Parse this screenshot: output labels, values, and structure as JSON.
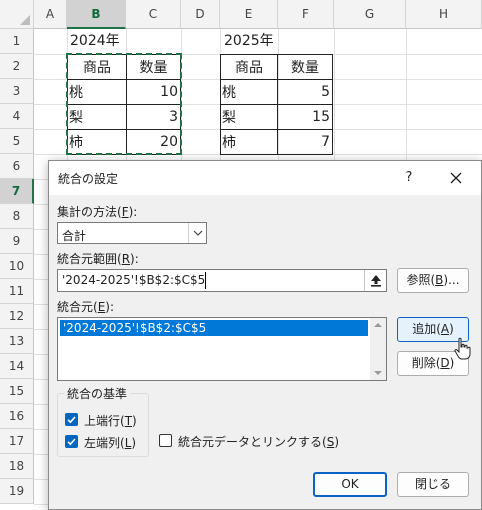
{
  "sheet": {
    "columns": [
      "A",
      "B",
      "C",
      "D",
      "E",
      "F",
      "G",
      "H"
    ],
    "rows": [
      "1",
      "2",
      "3",
      "4",
      "5",
      "6",
      "7",
      "8",
      "9",
      "10",
      "11",
      "12",
      "13",
      "14",
      "15",
      "16",
      "17",
      "18",
      "19"
    ],
    "selected_column": "B",
    "selected_row": "7",
    "table_2024": {
      "year_label": "2024年",
      "header_item": "商品",
      "header_qty": "数量",
      "rows": [
        {
          "item": "桃",
          "qty": "10"
        },
        {
          "item": "梨",
          "qty": "3"
        },
        {
          "item": "柿",
          "qty": "20"
        }
      ]
    },
    "table_2025": {
      "year_label": "2025年",
      "header_item": "商品",
      "header_qty": "数量",
      "rows": [
        {
          "item": "桃",
          "qty": "5"
        },
        {
          "item": "梨",
          "qty": "15"
        },
        {
          "item": "柿",
          "qty": "7"
        }
      ]
    },
    "colors": {
      "header_bg": "#f3f3f3",
      "selection_green": "#217346",
      "grid": "#e1e1e1"
    }
  },
  "dialog": {
    "title": "統合の設定",
    "help_label": "?",
    "function_label": "集計の方法(F):",
    "function_value": "合計",
    "reference_label": "統合元範囲(R):",
    "reference_value": "'2024-2025'!$B$2:$C$5",
    "browse_label": "参照(B)...",
    "all_references_label": "統合元(E):",
    "all_references": [
      "'2024-2025'!$B$2:$C$5"
    ],
    "add_label": "追加(A)",
    "delete_label": "削除(D)",
    "use_labels_title": "統合の基準",
    "top_row_label": "上端行(T)",
    "top_row_checked": true,
    "left_column_label": "左端列(L)",
    "left_column_checked": true,
    "link_label": "統合元データとリンクする(S)",
    "link_checked": false,
    "ok_label": "OK",
    "close_label": "閉じる",
    "accent_color": "#0078d7"
  }
}
